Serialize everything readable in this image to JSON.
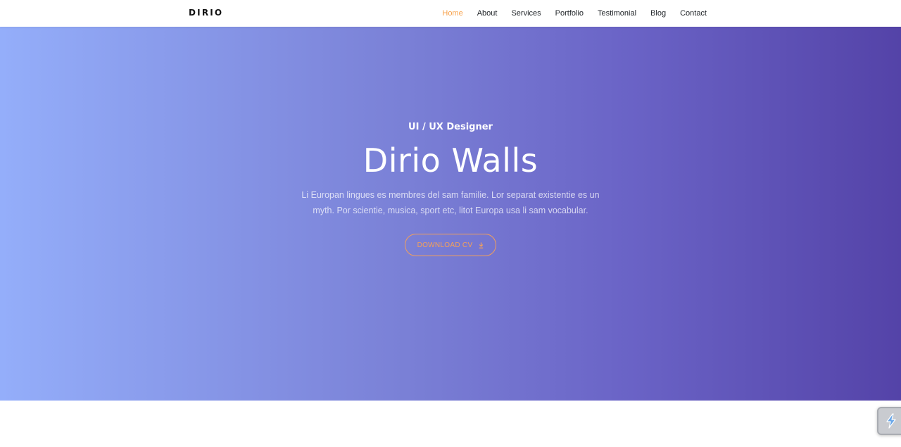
{
  "brand": "DIRIO",
  "nav": {
    "items": [
      {
        "label": "Home",
        "active": true
      },
      {
        "label": "About",
        "active": false
      },
      {
        "label": "Services",
        "active": false
      },
      {
        "label": "Portfolio",
        "active": false
      },
      {
        "label": "Testimonial",
        "active": false
      },
      {
        "label": "Blog",
        "active": false
      },
      {
        "label": "Contact",
        "active": false
      }
    ]
  },
  "hero": {
    "subtitle": "UI / UX Designer",
    "title": "Dirio Walls",
    "description": "Li Europan lingues es membres del sam familie. Lor separat existentie es un myth. Por scientie, musica, sport etc, litot Europa usa li sam vocabular.",
    "cta_label": "DOWNLOAD CV",
    "cta_icon": "download-icon"
  },
  "widget": {
    "icon": "lightning-icon"
  },
  "colors": {
    "accent": "#f7a24b",
    "gradient_start": "#94aefa",
    "gradient_end": "#5443a8",
    "nav_text": "#212529"
  }
}
